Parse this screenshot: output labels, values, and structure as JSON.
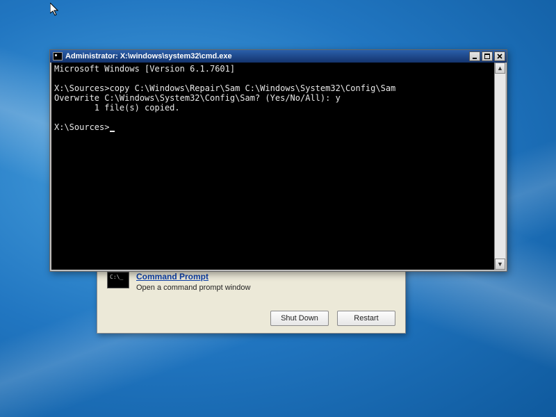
{
  "recovery": {
    "link_label": "Command Prompt",
    "description": "Open a command prompt window",
    "shutdown_label": "Shut Down",
    "restart_label": "Restart"
  },
  "cmd_window": {
    "title": "Administrator: X:\\windows\\system32\\cmd.exe",
    "lines": [
      "Microsoft Windows [Version 6.1.7601]",
      "",
      "X:\\Sources>copy C:\\Windows\\Repair\\Sam C:\\Windows\\System32\\Config\\Sam",
      "Overwrite C:\\Windows\\System32\\Config\\Sam? (Yes/No/All): y",
      "        1 file(s) copied.",
      "",
      "X:\\Sources>"
    ]
  }
}
